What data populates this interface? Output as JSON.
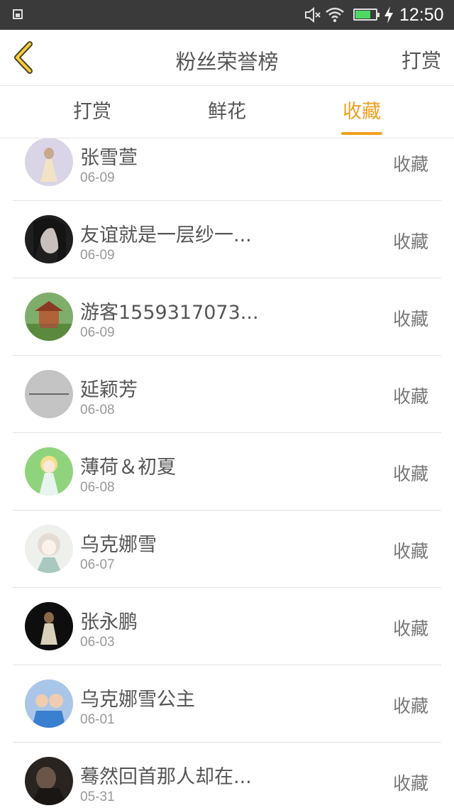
{
  "status_bar": {
    "time": "12:50",
    "battery_level": 0.7
  },
  "header": {
    "title": "粉丝荣誉榜",
    "right_action": "打赏",
    "back_icon": "chevron-left-icon"
  },
  "tabs": [
    {
      "label": "打赏",
      "active": false
    },
    {
      "label": "鲜花",
      "active": false
    },
    {
      "label": "收藏",
      "active": true
    }
  ],
  "colors": {
    "accent": "#f0a020",
    "status_bar_bg": "#3a3a3a",
    "text_primary": "#555555",
    "text_secondary": "#999999"
  },
  "list": [
    {
      "name": "张雪萱",
      "date": "06-09",
      "action": "收藏"
    },
    {
      "name": "友谊就是一层纱一...",
      "date": "06-09",
      "action": "收藏"
    },
    {
      "name": "游客1559317073...",
      "date": "06-09",
      "action": "收藏"
    },
    {
      "name": "延颖芳",
      "date": "06-08",
      "action": "收藏"
    },
    {
      "name": "薄荷＆初夏",
      "date": "06-08",
      "action": "收藏"
    },
    {
      "name": "乌克娜雪",
      "date": "06-07",
      "action": "收藏"
    },
    {
      "name": "张永鹏",
      "date": "06-03",
      "action": "收藏"
    },
    {
      "name": "乌克娜雪公主",
      "date": "06-01",
      "action": "收藏"
    },
    {
      "name": "蓦然回首那人却在...",
      "date": "05-31",
      "action": "收藏"
    }
  ]
}
